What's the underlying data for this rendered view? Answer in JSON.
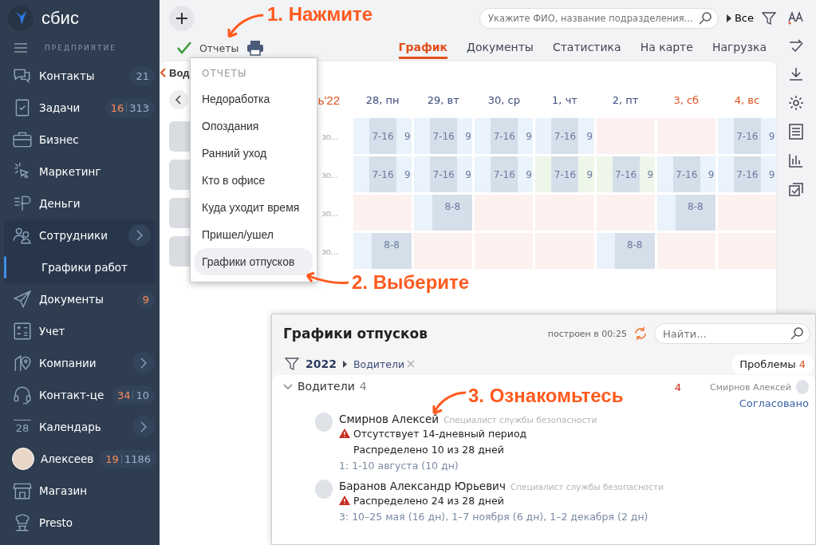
{
  "sidebar": {
    "logo": "сбис",
    "section": "ПРЕДПРИЯТИЕ",
    "items": [
      {
        "label": "Контакты",
        "selected": false,
        "counters": [
          {
            "text": "21",
            "kind": "plain"
          }
        ]
      },
      {
        "label": "Задачи",
        "selected": false,
        "counters": [
          {
            "text": "16",
            "kind": "accent"
          },
          {
            "text": "313",
            "kind": "plain"
          }
        ]
      },
      {
        "label": "Бизнес",
        "selected": false
      },
      {
        "label": "Маркетинг",
        "selected": false
      },
      {
        "label": "Деньги",
        "selected": false
      },
      {
        "label": "Сотрудники",
        "selected": false,
        "chevron": true,
        "children": [
          {
            "label": "Графики работ",
            "selected": true
          }
        ]
      },
      {
        "label": "Документы",
        "selected": false,
        "counters": [
          {
            "text": "9",
            "kind": "accent"
          }
        ]
      },
      {
        "label": "Учет",
        "selected": false
      },
      {
        "label": "Компании",
        "selected": false,
        "chevron": true
      },
      {
        "label": "Контакт-це",
        "selected": false,
        "counters": [
          {
            "text": "34",
            "kind": "accent"
          },
          {
            "text": "10",
            "kind": "plain"
          }
        ]
      },
      {
        "label": "Календарь",
        "selected": false,
        "chevron": true,
        "icon_label": "28"
      },
      {
        "label": "Алексеев",
        "selected": false,
        "kind": "avatar",
        "counters": [
          {
            "text": "19",
            "kind": "accent"
          },
          {
            "text": "1186",
            "kind": "plain"
          }
        ]
      },
      {
        "label": "Магазин",
        "selected": false
      },
      {
        "label": "Presto",
        "selected": false
      }
    ]
  },
  "toolbar": {
    "search_placeholder": "Укажите ФИО, название подразделения...",
    "scope": "Все",
    "reports": "Отчеты"
  },
  "tabs": [
    {
      "label": "График",
      "selected": true
    },
    {
      "label": "Документы",
      "selected": false
    },
    {
      "label": "Статистика",
      "selected": false
    },
    {
      "label": "На карте",
      "selected": false
    },
    {
      "label": "Нагрузка",
      "selected": false
    }
  ],
  "schedule": {
    "title": "Вод",
    "month": "ь'22",
    "days": [
      {
        "label": "28, пн",
        "weekend": false
      },
      {
        "label": "29, вт",
        "weekend": false
      },
      {
        "label": "30, ср",
        "weekend": false
      },
      {
        "label": "1, чт",
        "weekend": false
      },
      {
        "label": "2, пт",
        "weekend": false
      },
      {
        "label": "3, сб",
        "weekend": true
      },
      {
        "label": "4, вс",
        "weekend": true
      }
    ],
    "rows": [
      {
        "name": "зо...",
        "cells": [
          {
            "kind": "work",
            "shift": "7-16",
            "hours": "9"
          },
          {
            "kind": "work",
            "shift": "7-16",
            "hours": "9"
          },
          {
            "kind": "work",
            "shift": "7-16",
            "hours": "9"
          },
          {
            "kind": "work",
            "shift": "7-16",
            "hours": "9"
          },
          {
            "kind": "off"
          },
          {
            "kind": "off"
          },
          {
            "kind": "work",
            "shift": "7-16",
            "hours": "9"
          }
        ]
      },
      {
        "name": "зо...",
        "cells": [
          {
            "kind": "work",
            "shift": "7-16",
            "hours": "9"
          },
          {
            "kind": "work",
            "shift": "7-16",
            "hours": "9"
          },
          {
            "kind": "work",
            "shift": "7-16",
            "hours": "9"
          },
          {
            "kind": "present",
            "shift": "7-16",
            "hours": "9"
          },
          {
            "kind": "present",
            "shift": "7-16",
            "hours": "9"
          },
          {
            "kind": "work",
            "shift": "7-16",
            "hours": "9"
          },
          {
            "kind": "work",
            "shift": "7-16",
            "hours": "9"
          }
        ]
      },
      {
        "name": "зо...",
        "cells": [
          {
            "kind": "off"
          },
          {
            "kind": "work",
            "shift": "8-8"
          },
          {
            "kind": "off"
          },
          {
            "kind": "off"
          },
          {
            "kind": "off"
          },
          {
            "kind": "work",
            "shift": "8-8"
          },
          {
            "kind": "off"
          }
        ]
      },
      {
        "name": "зо...",
        "cells": [
          {
            "kind": "work",
            "shift": "8-8"
          },
          {
            "kind": "off"
          },
          {
            "kind": "off"
          },
          {
            "kind": "off"
          },
          {
            "kind": "work",
            "shift": "8-8"
          },
          {
            "kind": "off"
          },
          {
            "kind": "off"
          }
        ]
      }
    ]
  },
  "reports_menu": {
    "header": "ОТЧЕТЫ",
    "items": [
      {
        "label": "Недоработка",
        "selected": false
      },
      {
        "label": "Опоздания",
        "selected": false
      },
      {
        "label": "Ранний уход",
        "selected": false
      },
      {
        "label": "Кто в офисе",
        "selected": false
      },
      {
        "label": "Куда уходит время",
        "selected": false
      },
      {
        "label": "Пришел/ушел",
        "selected": false
      },
      {
        "label": "Графики отпусков",
        "selected": true
      }
    ]
  },
  "vacation_panel": {
    "title": "Графики отпусков",
    "built": "построен в 00:25",
    "search_placeholder": "Найти...",
    "year": "2022",
    "filter": "Водители",
    "problems": {
      "label": "Проблемы",
      "count": "4"
    },
    "group": {
      "name": "Водители",
      "count": "4",
      "expanded": true,
      "problems": "4",
      "approver": "Смирнов Алексей",
      "status": "Согласовано"
    },
    "employees": [
      {
        "name": "Смирнов Алексей",
        "role": "Специалист службы безопасности",
        "notes": [
          {
            "text": "Отсутствует 14-дневный период",
            "warning": true
          },
          {
            "text": "Распределено 10 из 28 дней",
            "warning": false
          }
        ],
        "periods": "1: 1-10 августа (10 дн)"
      },
      {
        "name": "Баранов Александр Юрьевич",
        "role": "Специалист службы безопасности",
        "notes": [
          {
            "text": "Распределено 24 из 28 дней",
            "warning": true
          }
        ],
        "periods": "3: 10–25 мая (16 дн), 1–7 ноября (6 дн), 1–2 декабря (2 дн)"
      }
    ]
  },
  "annotations": [
    {
      "text": "1. Нажмите"
    },
    {
      "text": "2. Выберите"
    },
    {
      "text": "3. Ознакомьтесь"
    }
  ]
}
